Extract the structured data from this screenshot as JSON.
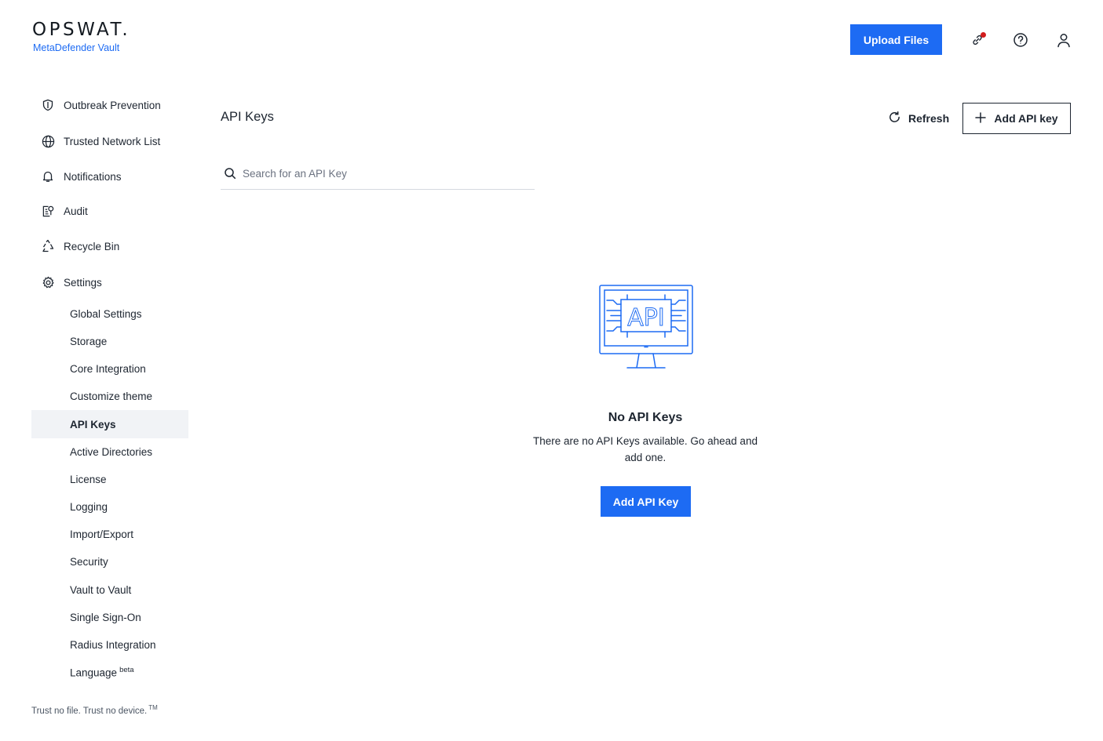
{
  "brand": {
    "logo": "OPSWAT.",
    "product": "MetaDefender Vault"
  },
  "header": {
    "upload_label": "Upload Files",
    "icons": [
      "link-icon",
      "help-icon",
      "user-icon"
    ],
    "notification_dot_color": "#d21d1d"
  },
  "sidebar": {
    "items": [
      {
        "label": "Outbreak Prevention",
        "icon": "shield-icon"
      },
      {
        "label": "Trusted Network List",
        "icon": "globe-icon"
      },
      {
        "label": "Notifications",
        "icon": "bell-icon"
      },
      {
        "label": "Audit",
        "icon": "audit-icon"
      },
      {
        "label": "Recycle Bin",
        "icon": "recycle-icon"
      },
      {
        "label": "Settings",
        "icon": "gear-icon"
      }
    ],
    "settings_children": [
      {
        "label": "Global Settings"
      },
      {
        "label": "Storage"
      },
      {
        "label": "Core Integration"
      },
      {
        "label": "Customize theme"
      },
      {
        "label": "API Keys",
        "active": true
      },
      {
        "label": "Active Directories"
      },
      {
        "label": "License"
      },
      {
        "label": "Logging"
      },
      {
        "label": "Import/Export"
      },
      {
        "label": "Security"
      },
      {
        "label": "Vault to Vault"
      },
      {
        "label": "Single Sign-On"
      },
      {
        "label": "Radius Integration"
      },
      {
        "label": "Language",
        "badge": "beta"
      }
    ]
  },
  "footer": {
    "tagline": "Trust no file. Trust no device.",
    "tm": "TM"
  },
  "main": {
    "title": "API Keys",
    "refresh_label": "Refresh",
    "add_label": "Add API key",
    "search_placeholder": "Search for an API Key",
    "search_value": "",
    "empty": {
      "illustration_text": "API",
      "title": "No API Keys",
      "description": "There are no API Keys available. Go ahead and add one.",
      "button_label": "Add API Key"
    }
  },
  "colors": {
    "accent": "#1d6bf3",
    "text": "#1d2530",
    "active_bg": "#f1f3f6"
  }
}
